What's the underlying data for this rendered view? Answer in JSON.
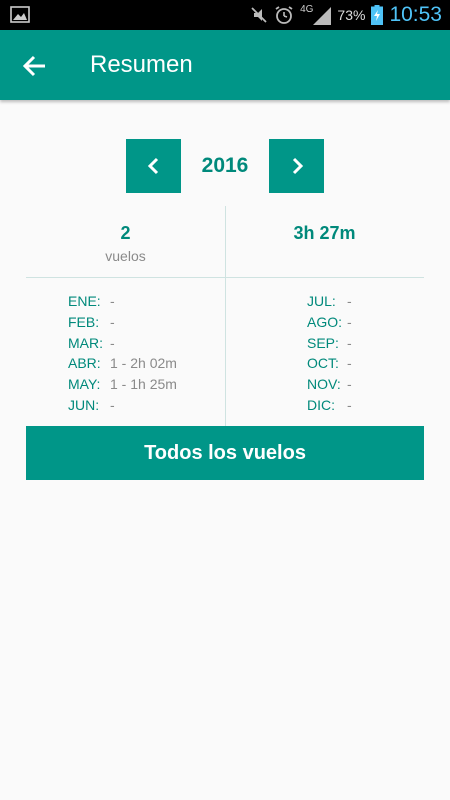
{
  "status_bar": {
    "battery": "73%",
    "time": "10:53",
    "network": "4G"
  },
  "app_bar": {
    "title": "Resumen"
  },
  "year_selector": {
    "year": "2016"
  },
  "stats": {
    "flights_count": "2",
    "flights_label": "vuelos",
    "total_time": "3h 27m"
  },
  "months_left": [
    {
      "name": "ENE:",
      "value": "-"
    },
    {
      "name": "FEB:",
      "value": "-"
    },
    {
      "name": "MAR:",
      "value": "-"
    },
    {
      "name": "ABR:",
      "value": "1 - 2h 02m"
    },
    {
      "name": "MAY:",
      "value": "1 - 1h 25m"
    },
    {
      "name": "JUN:",
      "value": "-"
    }
  ],
  "months_right": [
    {
      "name": "JUL:",
      "value": "-"
    },
    {
      "name": "AGO:",
      "value": "-"
    },
    {
      "name": "SEP:",
      "value": "-"
    },
    {
      "name": "OCT:",
      "value": "-"
    },
    {
      "name": "NOV:",
      "value": "-"
    },
    {
      "name": "DIC:",
      "value": "-"
    }
  ],
  "all_flights_button": "Todos los vuelos",
  "colors": {
    "primary": "#009688",
    "text_accent": "#00897b",
    "text_muted": "#8a8a8a"
  }
}
